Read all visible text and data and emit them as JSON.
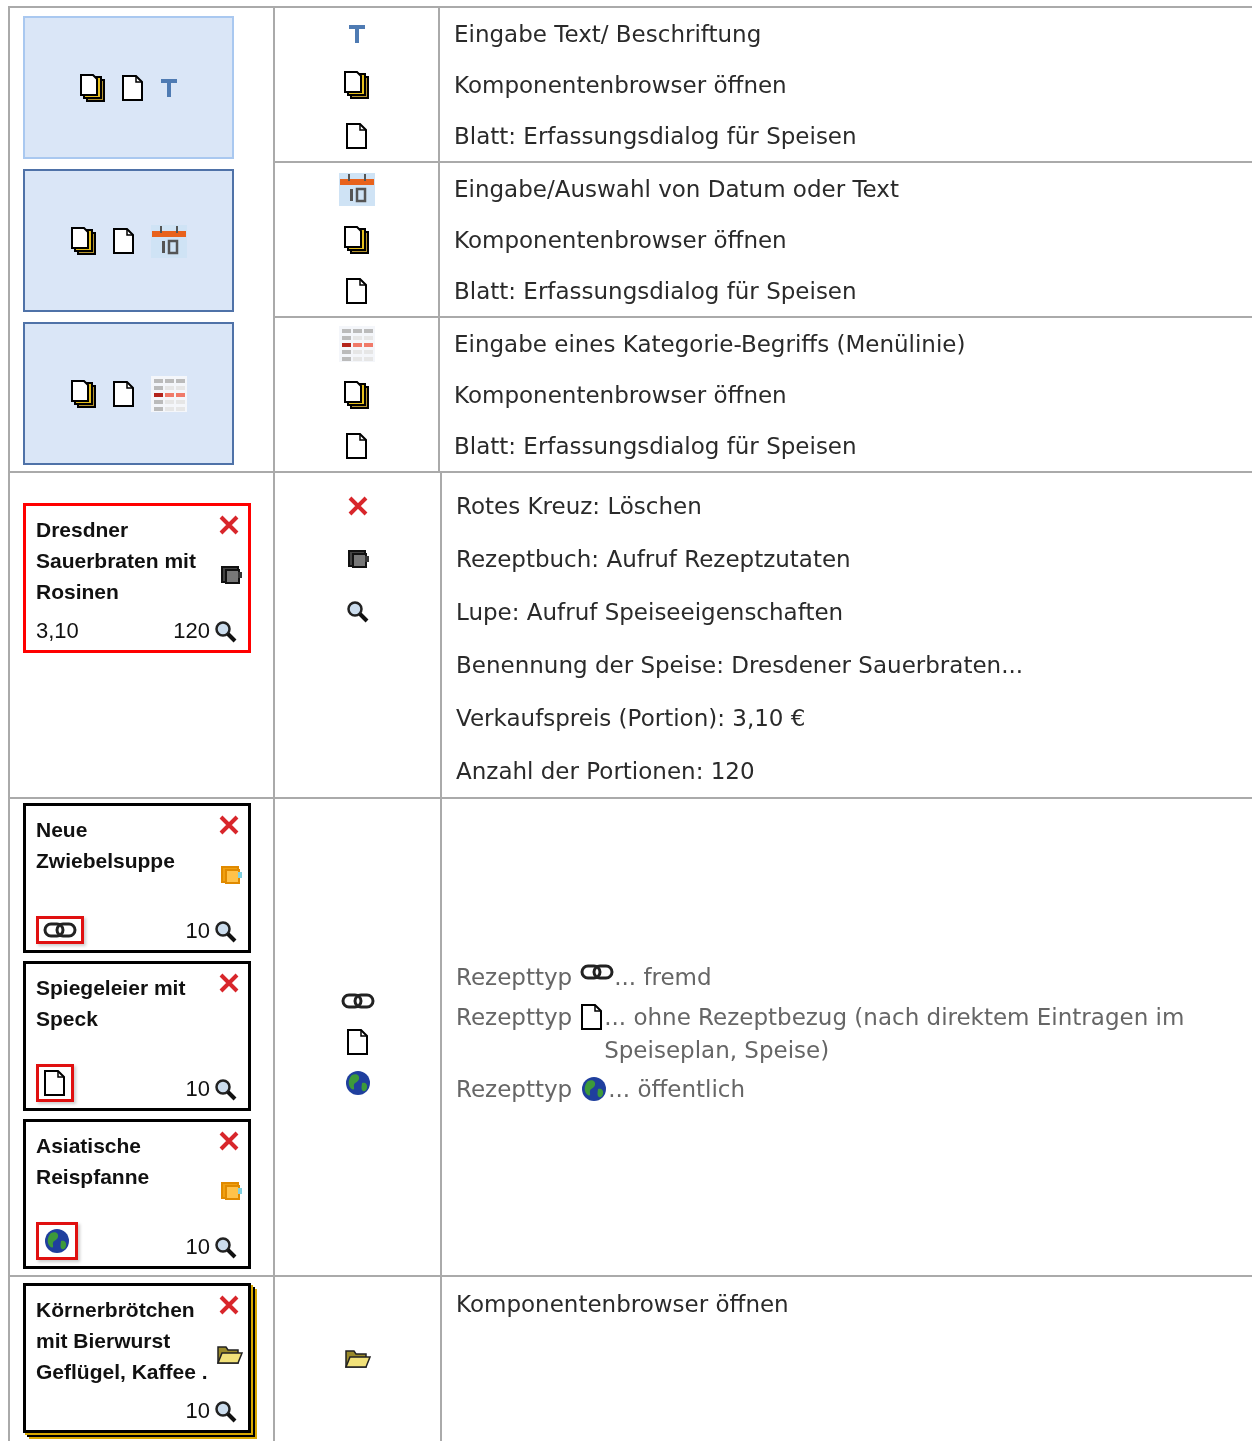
{
  "sections": [
    {
      "kind": "toolbox",
      "groups": [
        {
          "selected": true,
          "rows": [
            {
              "kind": "text-tool",
              "text": "Eingabe Text/ Beschriftung"
            },
            {
              "kind": "stack",
              "text": "Komponentenbrowser öffnen"
            },
            {
              "kind": "page",
              "text": "Blatt: Erfassungsdialog für Speisen"
            }
          ]
        },
        {
          "selected": false,
          "rows": [
            {
              "kind": "calendar",
              "text": "Eingabe/Auswahl von Datum oder Text"
            },
            {
              "kind": "stack",
              "text": "Komponentenbrowser öffnen"
            },
            {
              "kind": "page",
              "text": "Blatt: Erfassungsdialog für Speisen"
            }
          ]
        },
        {
          "selected": false,
          "rows": [
            {
              "kind": "grid",
              "text": "Eingabe eines Kategorie-Begriffs (Menülinie)"
            },
            {
              "kind": "stack",
              "text": "Komponentenbrowser öffnen"
            },
            {
              "kind": "page",
              "text": "Blatt: Erfassungsdialog für Speisen"
            }
          ]
        }
      ]
    },
    {
      "kind": "details",
      "cards": [
        {
          "title": "Dresdner Sauerbraten mit Rosinen",
          "price": "3,10",
          "count": "120",
          "selected": true,
          "stacked": false,
          "action": {
            "kind": "book-dark"
          }
        }
      ],
      "rows": [
        {
          "kind": "delete",
          "text": "Rotes Kreuz: Löschen"
        },
        {
          "kind": "book",
          "text": "Rezeptbuch: Aufruf Rezeptzutaten"
        },
        {
          "kind": "magnifier",
          "text": "Lupe: Aufruf Speiseeigenschaften"
        },
        {
          "kind": "none",
          "text": "Benennung der Speise: Dresdener Sauerbraten..."
        },
        {
          "kind": "none",
          "text": "Verkaufspreis (Portion): 3,10 €"
        },
        {
          "kind": "none",
          "text": "Anzahl der Portionen: 120"
        }
      ]
    },
    {
      "kind": "legend",
      "cards": [
        {
          "title": "Neue Zwiebelsuppe",
          "count": "10",
          "selected": false,
          "stacked": false,
          "action": {
            "kind": "book-orange"
          },
          "badge": {
            "kind": "link"
          }
        },
        {
          "title": "Spiegeleier mit Speck",
          "count": "10",
          "selected": false,
          "stacked": false,
          "badge": {
            "kind": "page"
          }
        },
        {
          "title": "Asiatische Reispfanne",
          "count": "10",
          "selected": false,
          "stacked": false,
          "action": {
            "kind": "book-orange"
          },
          "badge": {
            "kind": "globe"
          }
        }
      ],
      "rows": [
        {
          "kind": "link",
          "before": "Rezepttyp",
          "after": "... fremd"
        },
        {
          "kind": "page",
          "before": "Rezepttyp",
          "after": "... ohne Rezeptbezug (nach direktem Eintragen im Speiseplan, Speise)"
        },
        {
          "kind": "globe",
          "before": "Rezepttyp",
          "after": "... öffentlich"
        }
      ]
    },
    {
      "kind": "single",
      "cards": [
        {
          "title": "Körnerbrötchen mit Bierwurst Geflügel, Kaffee .",
          "count": "10",
          "selected": false,
          "stacked": true,
          "action": {
            "kind": "folder"
          }
        }
      ],
      "rows": [
        {
          "kind": "folder",
          "text": "Komponentenbrowser öffnen"
        }
      ]
    }
  ]
}
